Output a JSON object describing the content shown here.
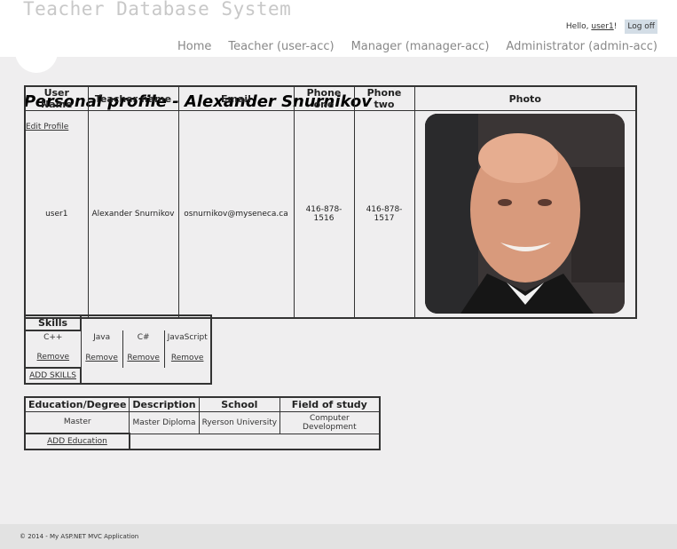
{
  "header": {
    "site_title": "Teacher Database System",
    "hello_prefix": "Hello, ",
    "username": "user1",
    "hello_suffix": "!",
    "logoff_label": "Log off"
  },
  "nav": [
    {
      "label": "Home"
    },
    {
      "label": "Teacher (user-acc)"
    },
    {
      "label": "Manager (manager-acc)"
    },
    {
      "label": "Administrator (admin-acc)"
    }
  ],
  "page": {
    "title": "Personal profile - Alexander Snurnikov",
    "edit_profile_label": "Edit Profile"
  },
  "profile_table": {
    "headers": [
      "User Name",
      "Teacher name",
      "Email",
      "Phone one",
      "Phone two",
      "Photo"
    ],
    "row": {
      "user_name": "user1",
      "teacher_name": "Alexander Snurnikov",
      "email": "osnurnikov@myseneca.ca",
      "phone_one": "416-878-1516",
      "phone_two": "416-878-1517"
    }
  },
  "skills": {
    "header": "Skills",
    "items": [
      {
        "name": "C++",
        "remove_label": "Remove"
      },
      {
        "name": "Java",
        "remove_label": "Remove"
      },
      {
        "name": "C#",
        "remove_label": "Remove"
      },
      {
        "name": "JavaScript",
        "remove_label": "Remove"
      }
    ],
    "add_label": "ADD SKILLS"
  },
  "education": {
    "headers": [
      "Education/Degree",
      "Description",
      "School",
      "Field of study"
    ],
    "row": {
      "degree": "Master",
      "description": "Master Diploma",
      "school": "Ryerson University",
      "field": "Computer Development"
    },
    "add_label": "ADD Education"
  },
  "footer": {
    "text": "© 2014 - My ASP.NET MVC Application"
  },
  "colors": {
    "main_background": "#efeeef",
    "footer_background": "#e2e2e2",
    "title_color": "#c8c8c8",
    "logoff_background": "#d3dde6"
  }
}
